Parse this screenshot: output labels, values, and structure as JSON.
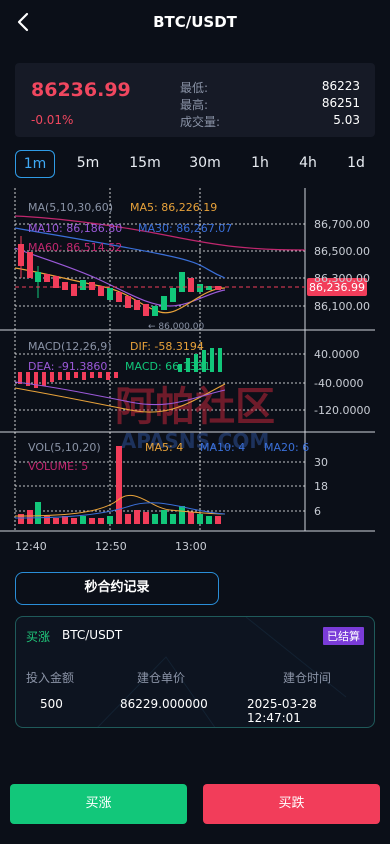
{
  "header": {
    "title": "BTC/USDT"
  },
  "ticker": {
    "price": "86236.99",
    "change": "-0.01%",
    "stats": [
      {
        "label": "最低:",
        "value": "86223"
      },
      {
        "label": "最高:",
        "value": "86251"
      },
      {
        "label": "成交量:",
        "value": "5.03"
      }
    ]
  },
  "intervals": [
    "1m",
    "5m",
    "15m",
    "30m",
    "1h",
    "4h",
    "1d"
  ],
  "chart": {
    "ma_header": "MA(5,10,30,60)",
    "ma5_label": "MA5: 86,226.19",
    "ma10_label": "MA10: 86,186.80",
    "ma30_label": "MA30: 86,267.07",
    "ma60_label": "MA60: 86,514.52",
    "price_ticks": [
      "86,700.00",
      "86,500.00",
      "86,300.00",
      "86,100.00"
    ],
    "last_price_tag": "86,236.99",
    "low_marker": "← 86,000.00",
    "macd_header": "MACD(12,26,9)",
    "dif_label": "DIF: -58.3194",
    "dea_label": "DEA: -91.3860",
    "macd_label": "MACD: 66.1331",
    "macd_ticks": [
      "40.0000",
      "-40.0000",
      "-120.0000"
    ],
    "vol_header": "VOL(5,10,20)",
    "vol_ma5": "MA5: 4",
    "vol_ma10": "MA10: 4",
    "vol_ma20": "MA20: 6",
    "volume_label": "VOLUME: 5",
    "vol_ticks": [
      "30",
      "18",
      "6"
    ],
    "time_ticks": [
      "12:40",
      "12:50",
      "13:00"
    ],
    "watermark": "阿帕社区",
    "watermark_sub": "APASNS.COM"
  },
  "chart_data": {
    "type": "candlestick",
    "x": [
      "12:40",
      "12:50",
      "13:00"
    ],
    "price_ylim": [
      86050,
      86750
    ],
    "volume_ticks": [
      6,
      18,
      30
    ],
    "macd_ticks": [
      40,
      -40,
      -120
    ],
    "last_price": 86236.99,
    "low_marker": 86000
  },
  "record_button": "秒合约记录",
  "order": {
    "direction": "买涨",
    "pair": "BTC/USDT",
    "status": "已结算",
    "headers": [
      "投入金额",
      "建仓单价",
      "建仓时间"
    ],
    "values": [
      "500",
      "86229.000000",
      "2025-03-28 12:47:01"
    ]
  },
  "footer": {
    "buy": "买涨",
    "sell": "买跌"
  },
  "colors": {
    "up": "#12c77a",
    "down": "#f23d5a",
    "accent": "#2f9be6"
  }
}
